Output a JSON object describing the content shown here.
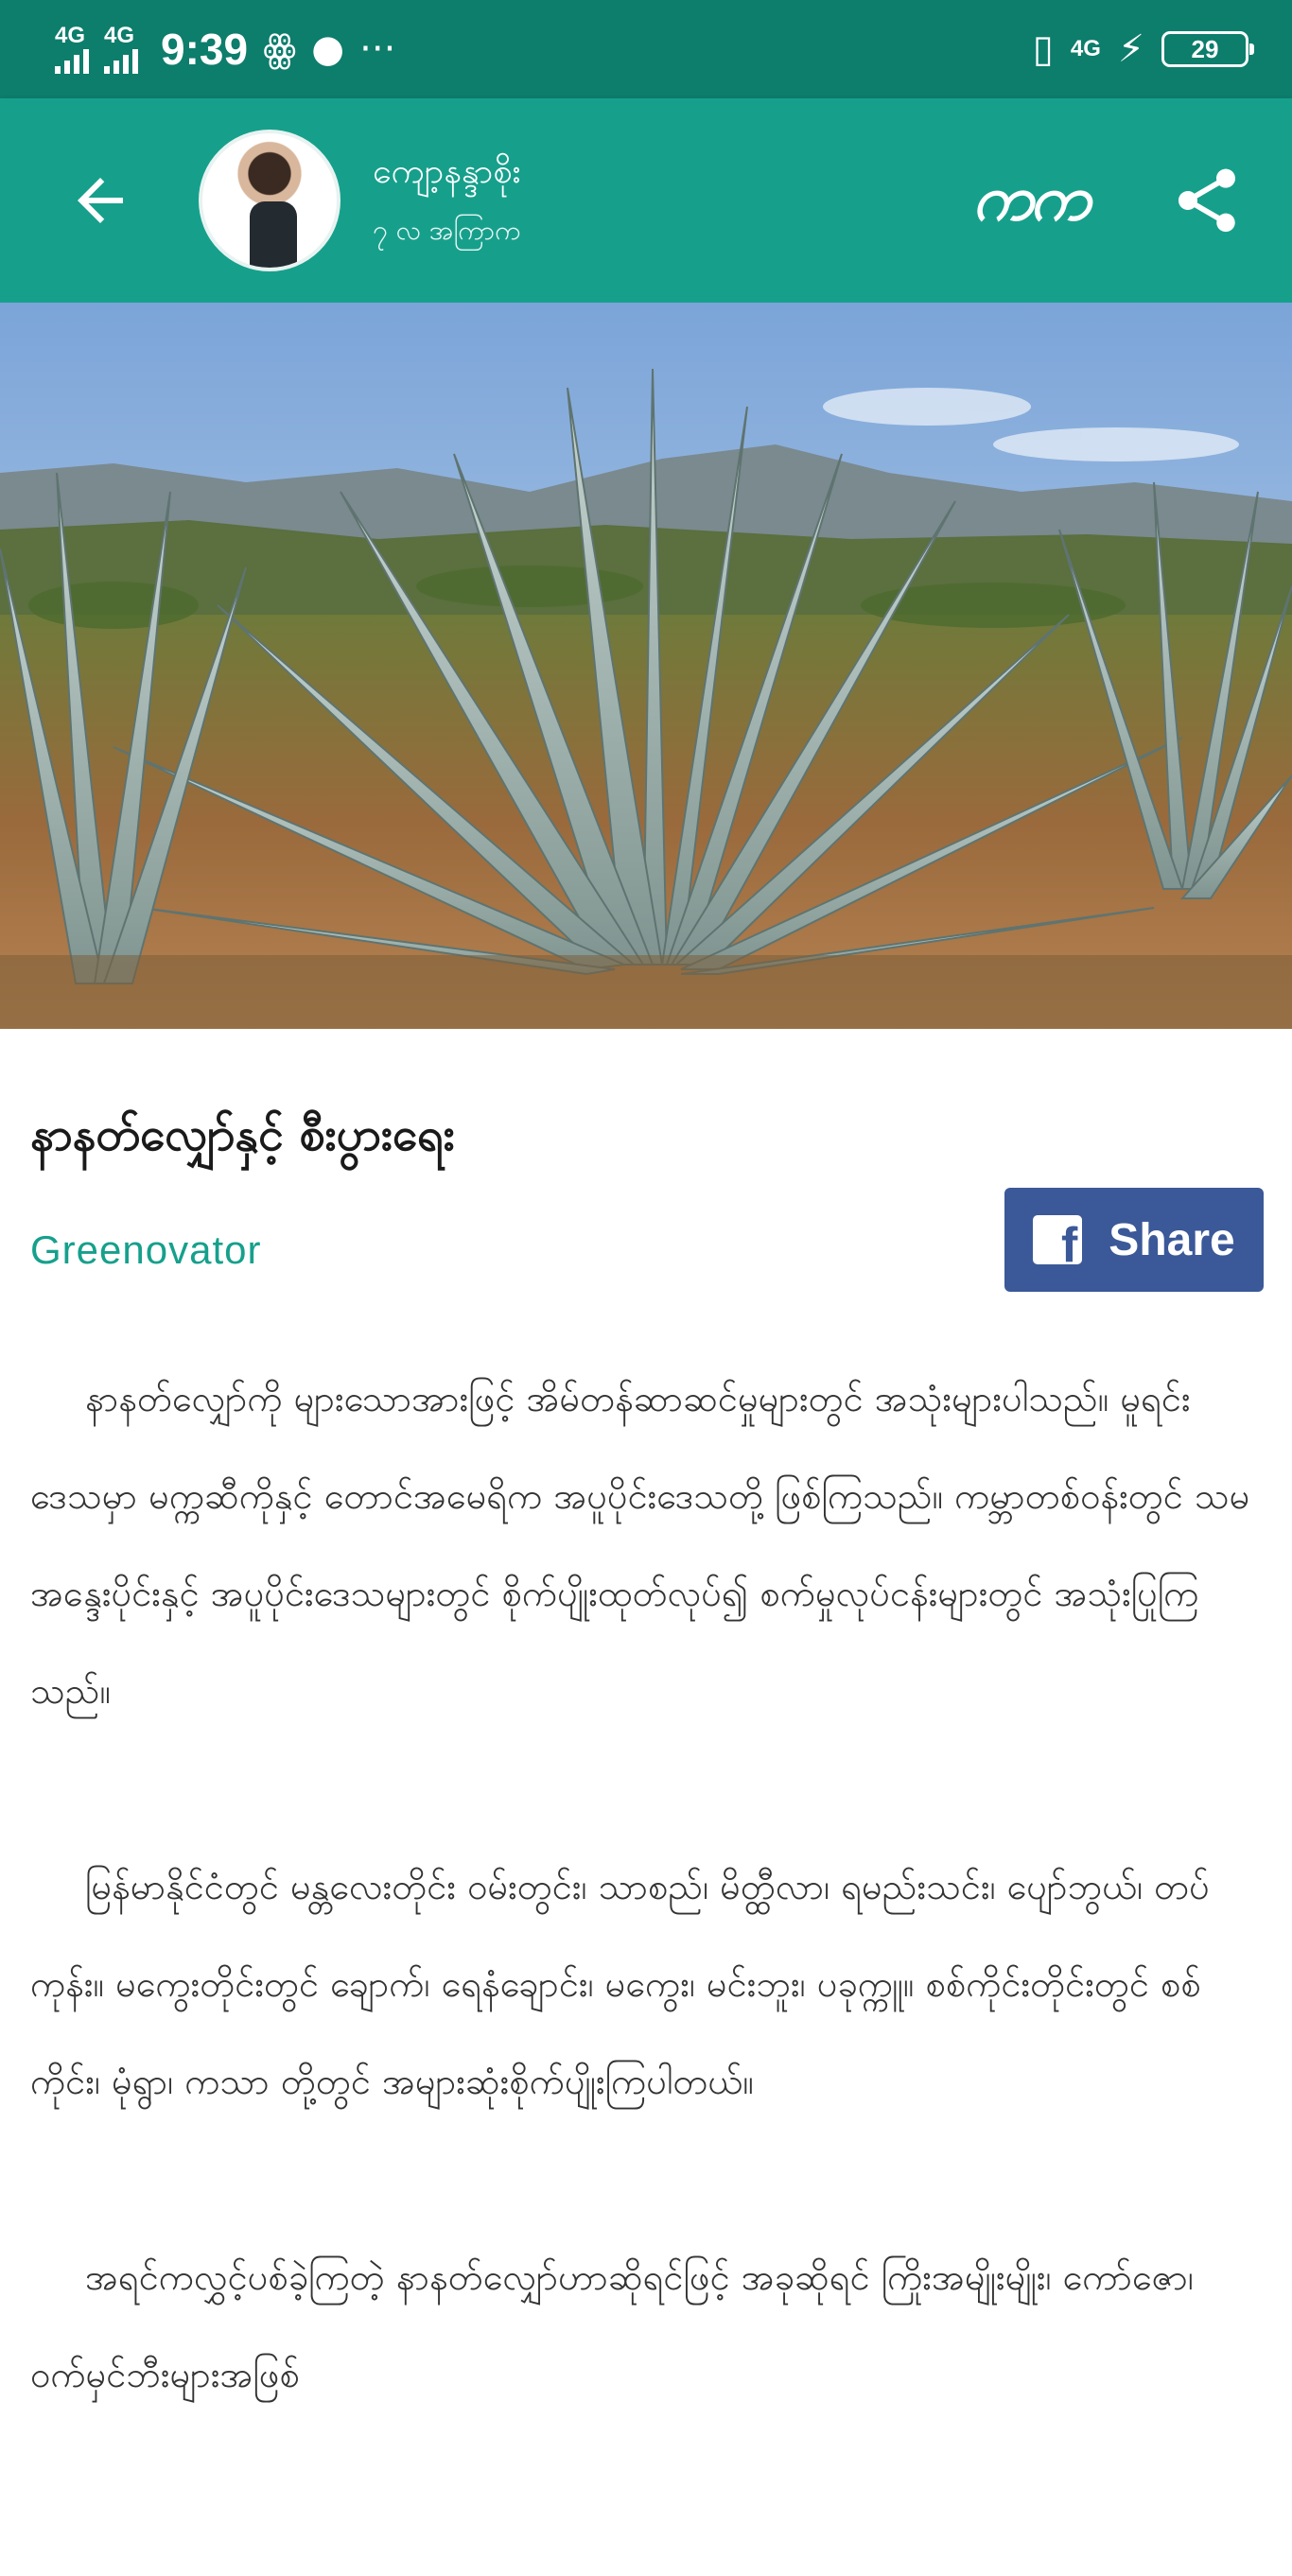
{
  "status_bar": {
    "network_1": "4G",
    "network_2": "4G",
    "time": "9:39",
    "notification_icons": [
      "sim-icon",
      "message-icon",
      "more-icon"
    ],
    "right_network": "4G",
    "battery_level": "29"
  },
  "app_bar": {
    "author_name": "ကျော့နန္ဒာစိုး",
    "posted_ago": "၇ လ အကြာက",
    "font_button_label": "ကက"
  },
  "article": {
    "title": "နာနတ်လျှော်နှင့် စီးပွားရေး",
    "source": "Greenovator",
    "share_label": "Share",
    "paragraphs": [
      "နာနတ်လျှော်ကို များသောအားဖြင့် အိမ်တန်ဆာဆင်မှုများတွင် အသုံးများပါသည်။ မူရင်းဒေသမှာ မက္ကဆီကိုနှင့် တောင်အမေရိက အပူပိုင်းဒေသတို့ ဖြစ်ကြသည်။ ကမ္ဘာတစ်ဝန်းတွင် သမအန္ဒေးပိုင်းနှင့် အပူပိုင်းဒေသများတွင် စိုက်ပျိုးထုတ်လုပ်၍ စက်မှုလုပ်ငန်းများတွင် အသုံးပြုကြသည်။",
      "မြန်မာနိုင်ငံတွင် မန္တလေးတိုင်း ဝမ်းတွင်း၊ သာစည်၊ မိတ္ထီလာ၊ ရမည်းသင်း၊ ပျော်ဘွယ်၊ တပ်ကုန်း။ မကွေးတိုင်းတွင် ချောက်၊ ရေနံချောင်း၊ မကွေး၊ မင်းဘူး၊ ပခုက္ကူ။ စစ်ကိုင်းတိုင်းတွင် စစ်ကိုင်း၊ မုံရွာ၊ ကသာ တို့တွင် အများဆုံးစိုက်ပျိုးကြပါတယ်။",
      "အရင်ကလွှင့်ပစ်ခဲ့ကြတဲ့ နာနတ်လျှော်ဟာဆိုရင်ဖြင့် အခုဆိုရင် ကြိုးအမျိုးမျိုး၊ ကော်ဇော၊ ဝက်မှင်ဘီးများအဖြစ်"
    ]
  },
  "colors": {
    "status_bar": "#0d7d6c",
    "app_bar": "#16a08c",
    "accent": "#16a08c",
    "facebook": "#3b5998"
  }
}
